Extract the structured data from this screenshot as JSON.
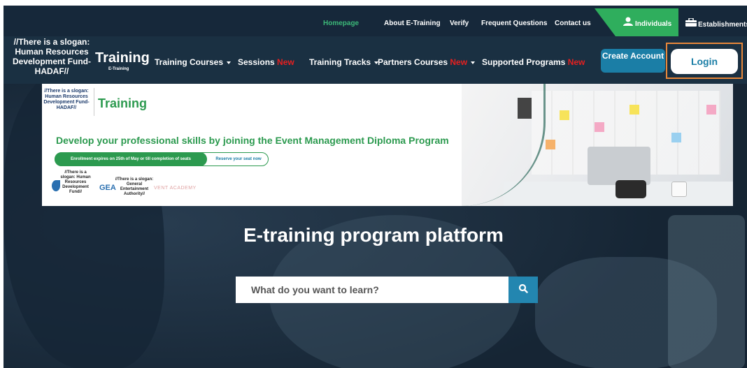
{
  "topnav": {
    "items": [
      "Homepage",
      "About E-Training",
      "Verify",
      "Frequent Questions",
      "Contact us"
    ],
    "active": "Homepage",
    "individuals_label": "Individuals",
    "establishments_label": "Establishments",
    "individuals_icon": "user-icon",
    "establishments_icon": "briefcase-icon"
  },
  "header": {
    "slogan": "//There is a slogan: Human Resources Development Fund- HADAF//",
    "brand": "Training",
    "brand_sub": "E-Training",
    "nav": {
      "training_courses": "Training Courses",
      "sessions": "Sessions",
      "sessions_badge": "New",
      "training_tracks": "Training Tracks",
      "partners_courses": "Partners Courses",
      "partners_badge": "New",
      "supported_programs": "Supported Programs",
      "supported_badge": "New"
    },
    "create_account": "Create Account",
    "login": "Login"
  },
  "banner": {
    "slogan": "//There is a slogan: Human Resources Development Fund-HADAF//",
    "brand": "Training",
    "headline": "Develop your professional skills by joining the Event Management Diploma Program",
    "enrollment": "Enrollment  expires on 25th of May or till completion of seats",
    "reserve": "Reserve your seat now",
    "logo1": "//There is a slogan: Human Resources Development Fund//",
    "gea": "GEA",
    "logo2": "//There is a slogan: General Entertainment Authority//",
    "academy": "VENT ACADEMY"
  },
  "hero": {
    "title": "E-training program platform",
    "search_placeholder": "What do you want to learn?",
    "search_icon": "search-icon"
  },
  "colors": {
    "accent_green": "#2fae5d",
    "brand_blue": "#1b7ea6",
    "new_red": "#e52020",
    "highlight_orange": "#e8883a",
    "nav_bg": "#16283a"
  }
}
